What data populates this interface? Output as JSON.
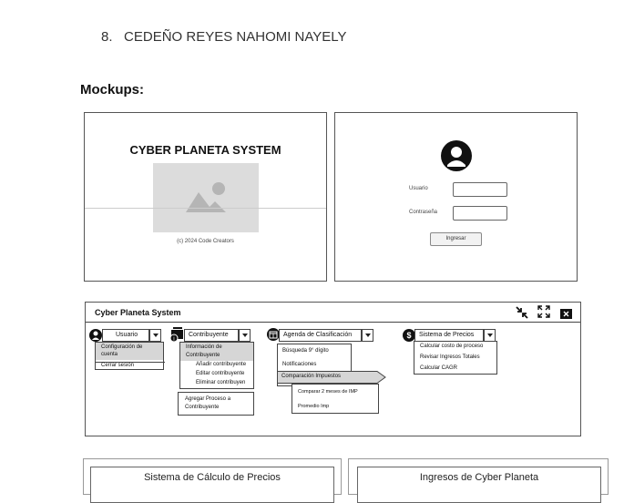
{
  "heading": {
    "number": "8.",
    "name": "CEDEÑO REYES NAHOMI NAYELY"
  },
  "mockups_label": "Mockups:",
  "splash": {
    "title": "CYBER PLANETA SYSTEM",
    "copyright": "(c) 2024 Code Creators",
    "icon": "image-placeholder-icon"
  },
  "login": {
    "avatar_icon": "user-avatar-icon",
    "user_label": "Usuario",
    "password_label": "Contraseña",
    "submit_label": "Ingresar"
  },
  "app": {
    "title": "Cyber Planeta System",
    "window_icons": [
      "collapse-arrows-icon",
      "expand-icon",
      "close-icon"
    ],
    "menus": {
      "usuario": {
        "label": "Usuario",
        "icon": "user-icon",
        "items": [
          "Configuración de cuenta",
          "Cerrar sesión"
        ]
      },
      "contribuyente": {
        "label": "Contribuyente",
        "icon": "folder-user-icon",
        "items": [
          "Información de Contribuyente"
        ],
        "submenu": [
          "Añadir contribuyente",
          "Editar contribuyente",
          "Eliminar contribuyen"
        ],
        "extra": "Agregar Proceso a Contribuyente"
      },
      "agenda": {
        "label": "Agenda de Clasificación",
        "icon": "calendar-icon",
        "items": [
          "Búsqueda 9° dígito",
          "Notificaciones",
          "Comparación Impuestos"
        ],
        "submenu": [
          "Comparar 2 meses de IMP",
          "Promedio Imp"
        ]
      },
      "precios": {
        "label": "Sistema de Precios",
        "icon": "dollar-icon",
        "icon_glyph": "$",
        "items": [
          "Calcular costo de proceso",
          "Revisar Ingresos Totales",
          "Calcular CAGR"
        ]
      }
    }
  },
  "cards": {
    "left_title": "Sistema de Cálculo de Precios",
    "right_title": "Ingresos de Cyber Planeta"
  }
}
